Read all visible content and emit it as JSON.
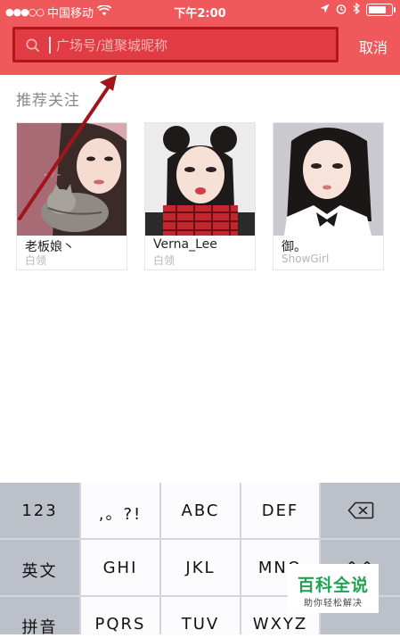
{
  "status_bar": {
    "signal_dots": "●●●○○",
    "carrier": "中国移动",
    "time": "下午2:00",
    "battery_level": 0.85,
    "icons": [
      "wifi-icon",
      "location-icon",
      "alarm-icon",
      "bluetooth-icon",
      "battery-icon"
    ]
  },
  "search": {
    "placeholder": "广场号/道聚城昵称",
    "value": "",
    "cancel_label": "取消"
  },
  "recommend": {
    "title": "推荐关注",
    "users": [
      {
        "name": "老板娘丶",
        "tag": "白领",
        "image": "portrait-with-cat"
      },
      {
        "name": "Verna_Lee",
        "tag": "白领",
        "image": "portrait-red-scarf"
      },
      {
        "name": "御。",
        "tag": "ShowGirl",
        "image": "portrait-white-collar"
      }
    ]
  },
  "keyboard": {
    "rows": [
      [
        "123",
        ",。?!",
        "ABC",
        "DEF",
        "delete-icon"
      ],
      [
        "英文",
        "GHI",
        "JKL",
        "MNO",
        "^^"
      ],
      [
        "拼音",
        "PQRS",
        "TUV",
        "WXYZ",
        ""
      ]
    ]
  },
  "watermark": {
    "title": "百科全说",
    "subtitle": "助你轻松解决"
  },
  "colors": {
    "header": "#f0595b",
    "search_highlight": "#b5141c",
    "annotation_arrow": "#a0141a",
    "watermark_green": "#20a354"
  }
}
